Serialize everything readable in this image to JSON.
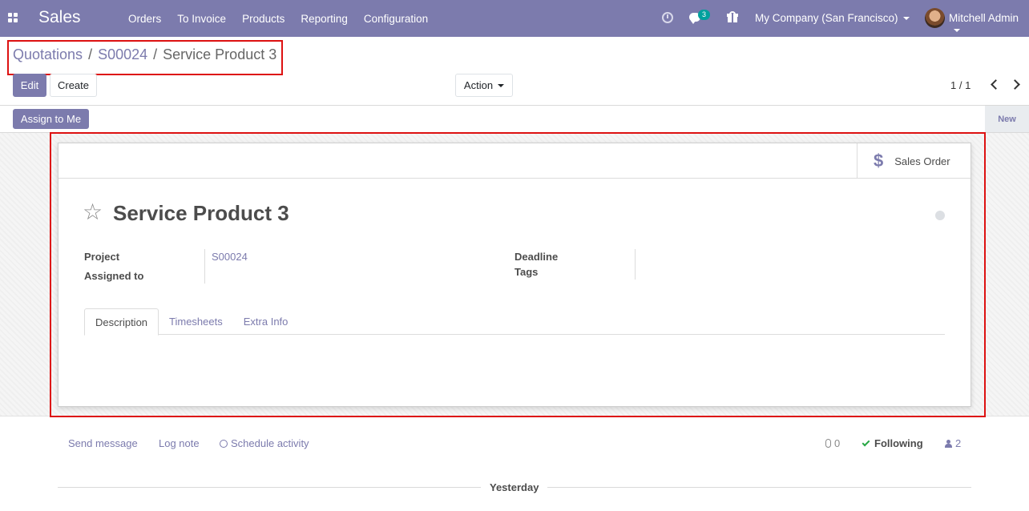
{
  "navbar": {
    "app_name": "Sales",
    "menu": [
      "Orders",
      "To Invoice",
      "Products",
      "Reporting",
      "Configuration"
    ],
    "chat_count": "3",
    "company": "My Company (San Francisco)",
    "user": "Mitchell Admin",
    "accent_color": "#7c7bad"
  },
  "breadcrumb": {
    "items": [
      "Quotations",
      "S00024"
    ],
    "current": "Service Product 3"
  },
  "toolbar": {
    "edit_label": "Edit",
    "create_label": "Create",
    "action_label": "Action",
    "pager": "1 / 1"
  },
  "statusbar": {
    "assign_label": "Assign to Me",
    "stage": "New"
  },
  "form": {
    "smart_button_label": "Sales Order",
    "title": "Service Product 3",
    "fields": {
      "project_label": "Project",
      "project_value": "S00024",
      "assigned_label": "Assigned to",
      "deadline_label": "Deadline",
      "tags_label": "Tags"
    },
    "tabs": [
      "Description",
      "Timesheets",
      "Extra Info"
    ]
  },
  "chatter": {
    "send_message": "Send message",
    "log_note": "Log note",
    "schedule_activity": "Schedule activity",
    "attachments": "0",
    "following": "Following",
    "followers": "2",
    "date_separator": "Yesterday"
  }
}
